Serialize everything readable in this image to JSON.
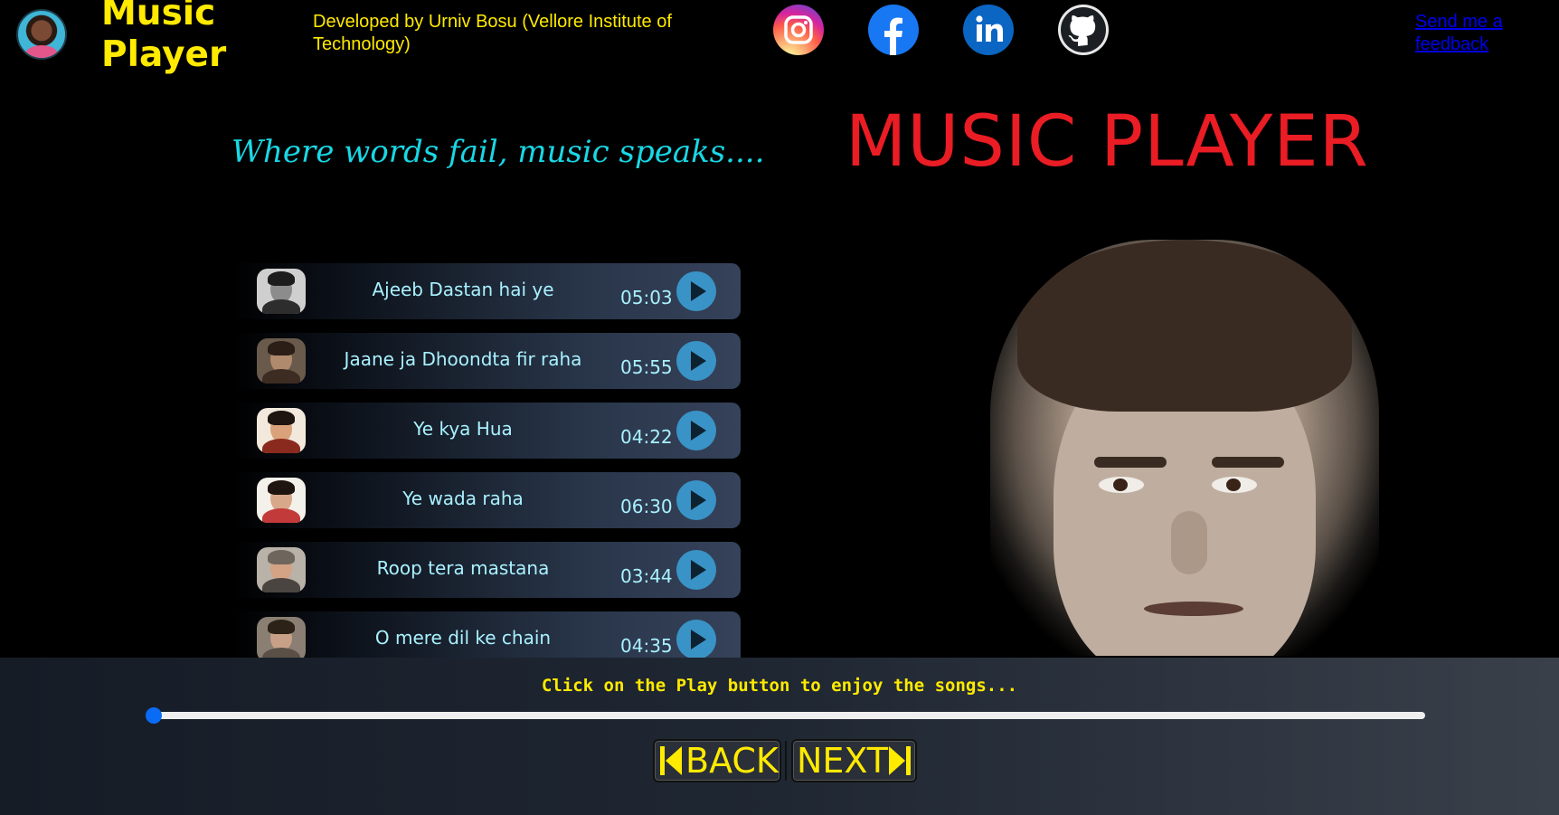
{
  "header": {
    "brand": "Music Player",
    "developer": "Developed by Urniv Bosu (Vellore Institute of Technology)",
    "feedback_link": "Send me a feedback",
    "social": [
      {
        "name": "instagram-icon"
      },
      {
        "name": "facebook-icon"
      },
      {
        "name": "linkedin-icon"
      },
      {
        "name": "github-icon"
      }
    ]
  },
  "main": {
    "tagline": "Where words fail, music speaks....",
    "title": "MUSIC PLAYER"
  },
  "songs": [
    {
      "title": "Ajeeb Dastan hai ye",
      "duration": "05:03"
    },
    {
      "title": "Jaane ja Dhoondta fir raha",
      "duration": "05:55"
    },
    {
      "title": "Ye kya Hua",
      "duration": "04:22"
    },
    {
      "title": "Ye wada raha",
      "duration": "06:30"
    },
    {
      "title": "Roop tera mastana",
      "duration": "03:44"
    },
    {
      "title": "O mere dil ke chain",
      "duration": "04:35"
    }
  ],
  "player": {
    "status": "Click on the Play button to enjoy the songs...",
    "progress": 0,
    "back_label": "BACK",
    "next_label": "NEXT"
  },
  "colors": {
    "accent_yellow": "#ffea00",
    "tagline_cyan": "#19d8e6",
    "title_red": "#ea1c24",
    "play_blue": "#3a93c6",
    "progress_knob": "#0a6cf5"
  }
}
